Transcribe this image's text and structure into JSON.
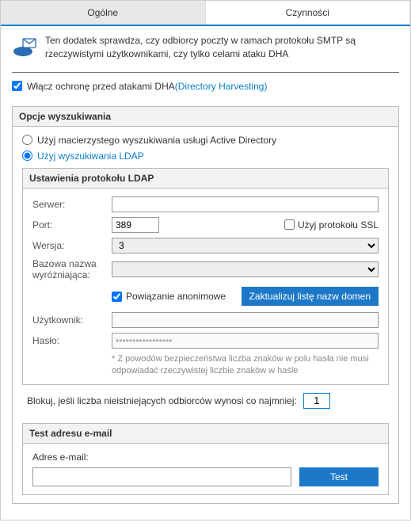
{
  "tabs": {
    "general": "Ogólne",
    "actions": "Czynności"
  },
  "intro": "Ten dodatek sprawdza, czy odbiorcy poczty w ramach protokołu SMTP są rzeczywistymi użytkownikami, czy tylko celami ataku DHA",
  "enable": {
    "prefix": "Włącz ochronę przed atakami DHA ",
    "link": "(Directory Harvesting)"
  },
  "search": {
    "title": "Opcje wyszukiwania",
    "radio_ad": "Użyj macierzystego wyszukiwania usługi Active Directory",
    "radio_ldap": "Użyj wyszukiwania LDAP"
  },
  "ldap": {
    "title": "Ustawienia protokołu LDAP",
    "server": "Serwer:",
    "port": "Port:",
    "port_value": "389",
    "ssl": "Użyj protokołu SSL",
    "version": "Wersja:",
    "version_value": "3",
    "basedn": "Bazowa nazwa wyróżniająca:",
    "anon": "Powiązanie anonimowe",
    "update_btn": "Zaktualizuj listę nazw domen",
    "user": "Użytkownik:",
    "pass": "Hasło:",
    "pass_value": "•••••••••••••••••",
    "hint": "* Z powodów bezpieczeństwa liczba znaków w polu hasła nie musi odpowiadać rzeczywistej liczbie znaków w haśle"
  },
  "block": {
    "label": "Blokuj, jeśli liczba nieistniejących odbiorców wynosi co najmniej:",
    "value": "1"
  },
  "test": {
    "title": "Test adresu e-mail",
    "label": "Adres e-mail:",
    "button": "Test"
  }
}
